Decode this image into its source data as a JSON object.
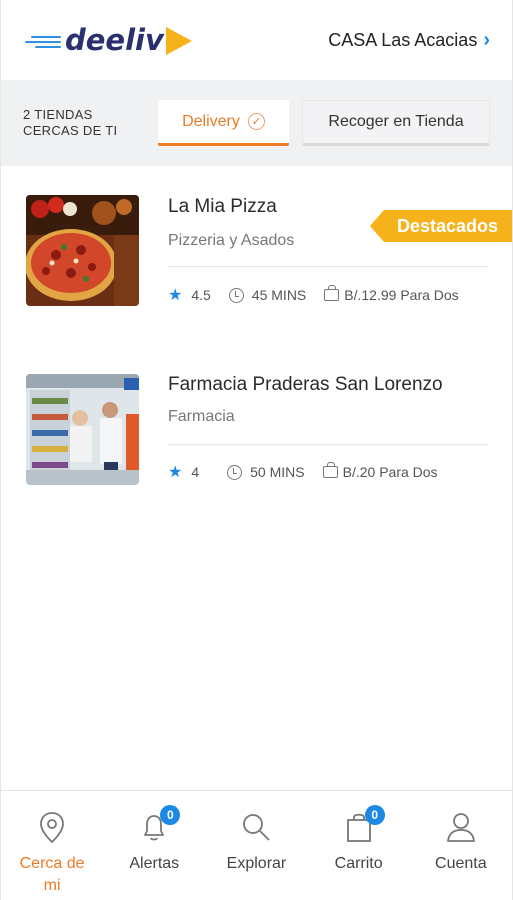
{
  "header": {
    "logo_text": "deeliv",
    "location": "CASA Las Acacias"
  },
  "modebar": {
    "nearby_line1": "2 TIENDAS",
    "nearby_line2": "CERCAS DE TI",
    "delivery_label": "Delivery",
    "pickup_label": "Recoger en Tienda"
  },
  "stores": [
    {
      "name": "La Mia Pizza",
      "category": "Pizzeria y Asados",
      "rating": "4.5",
      "time": "45 MINS",
      "price": "B/.12.99 Para Dos",
      "badge": "Destacados"
    },
    {
      "name": "Farmacia Praderas San Lorenzo",
      "category": "Farmacia",
      "rating": "4",
      "time": "50 MINS",
      "price": "B/.20 Para Dos"
    }
  ],
  "bottomnav": {
    "near_line1": "Cerca de",
    "near_line2": "mi",
    "alerts": "Alertas",
    "alerts_count": "0",
    "explore": "Explorar",
    "cart": "Carrito",
    "cart_count": "0",
    "account": "Cuenta"
  },
  "colors": {
    "accent": "#f07a23",
    "brand_blue": "#1e88e5",
    "badge": "#f6b21b"
  }
}
